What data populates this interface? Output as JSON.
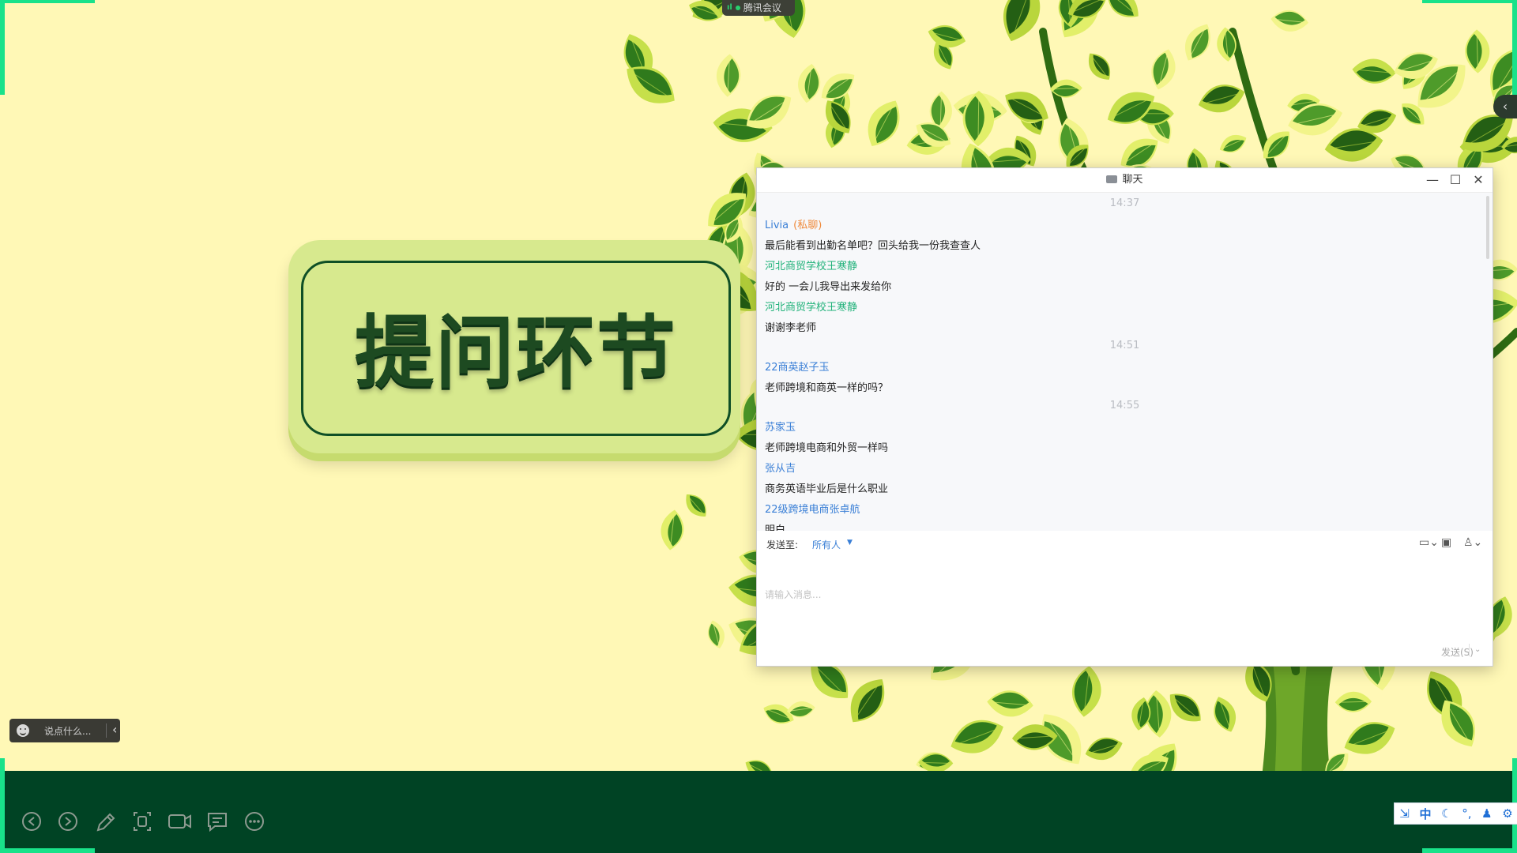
{
  "app": {
    "name": "腾讯会议"
  },
  "slide": {
    "title": "提问环节"
  },
  "chat": {
    "window_title": "聊天",
    "messages": [
      {
        "kind": "time",
        "text": "14:37"
      },
      {
        "kind": "sender",
        "name": "Livia",
        "tag": "(私聊)",
        "color": "#3a7fd6"
      },
      {
        "kind": "text",
        "text": "最后能看到出勤名单吧？回头给我一份我查查人"
      },
      {
        "kind": "sender",
        "name": "河北商贸学校王寒静",
        "color": "#21b27a"
      },
      {
        "kind": "text",
        "text": "好的 一会儿我导出来发给你"
      },
      {
        "kind": "sender",
        "name": "河北商贸学校王寒静",
        "color": "#21b27a"
      },
      {
        "kind": "text",
        "text": "谢谢李老师"
      },
      {
        "kind": "time",
        "text": "14:51"
      },
      {
        "kind": "sender",
        "name": "22商英赵子玉",
        "color": "#3a7fd6"
      },
      {
        "kind": "text",
        "text": "老师跨境和商英一样的吗？"
      },
      {
        "kind": "time",
        "text": "14:55"
      },
      {
        "kind": "sender",
        "name": "苏家玉",
        "color": "#3a7fd6"
      },
      {
        "kind": "text",
        "text": "老师跨境电商和外贸一样吗"
      },
      {
        "kind": "sender",
        "name": "张从吉",
        "color": "#3a7fd6"
      },
      {
        "kind": "text",
        "text": "商务英语毕业后是什么职业"
      },
      {
        "kind": "sender",
        "name": "22级跨境电商张卓航",
        "color": "#3a7fd6"
      },
      {
        "kind": "text",
        "text": "明白"
      }
    ],
    "send_to_label": "发送至:",
    "send_to_value": "所有人",
    "input_placeholder": "请输入消息...",
    "send_button": "发送(S)",
    "toolbar_icons": [
      "folder-icon",
      "screenshot-icon",
      "user-icon"
    ]
  },
  "danmaku": {
    "placeholder": "说点什么..."
  },
  "toolbar": {
    "buttons": [
      "previous-page-icon",
      "next-page-icon",
      "pen-icon",
      "screenshot-icon",
      "camera-icon",
      "comment-icon",
      "more-icon"
    ]
  },
  "ime": {
    "mode": "中"
  },
  "colors": {
    "accent_blue": "#3a7fd6",
    "sender_green": "#21b27a",
    "private_orange": "#ef8a3b",
    "frame_green": "#19e28a",
    "slide_bg": "#fff8b6",
    "band_green": "#004324"
  }
}
